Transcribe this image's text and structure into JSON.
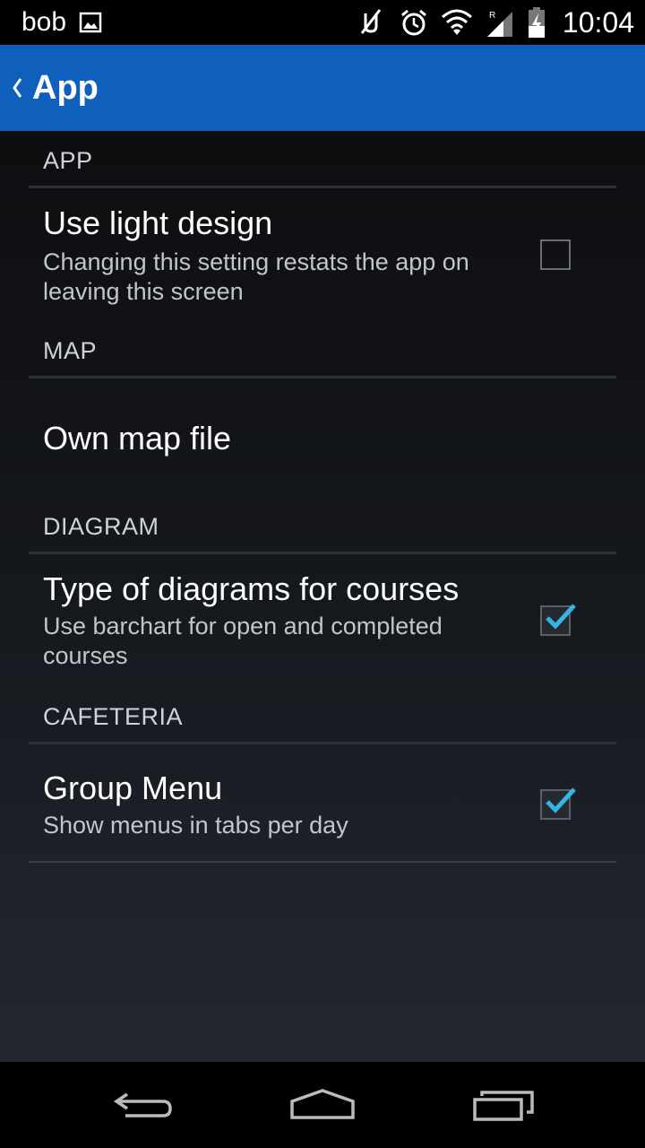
{
  "status_bar": {
    "carrier": "bob",
    "time": "10:04",
    "icons": [
      "image-icon",
      "mute-icon",
      "alarm-icon",
      "wifi-icon",
      "signal-roaming-icon",
      "battery-charging-icon"
    ]
  },
  "action_bar": {
    "title": "App",
    "color": "#0f5fbd"
  },
  "sections": {
    "app": {
      "header": "APP",
      "pref": {
        "title": "Use light design",
        "summary": "Changing this setting restats the app on leaving this screen",
        "checked": false
      }
    },
    "map": {
      "header": "MAP",
      "pref": {
        "title": "Own map file"
      }
    },
    "diagram": {
      "header": "DIAGRAM",
      "pref": {
        "title": "Type of diagrams for courses",
        "summary": "Use barchart for open and completed courses",
        "checked": true
      }
    },
    "cafeteria": {
      "header": "CAFETERIA",
      "pref": {
        "title": "Group Menu",
        "summary": "Show menus in tabs per day",
        "checked": true
      }
    }
  },
  "accent_color": "#33b5e5",
  "nav_bar": {
    "buttons": [
      "back-icon",
      "home-icon",
      "recents-icon"
    ]
  }
}
